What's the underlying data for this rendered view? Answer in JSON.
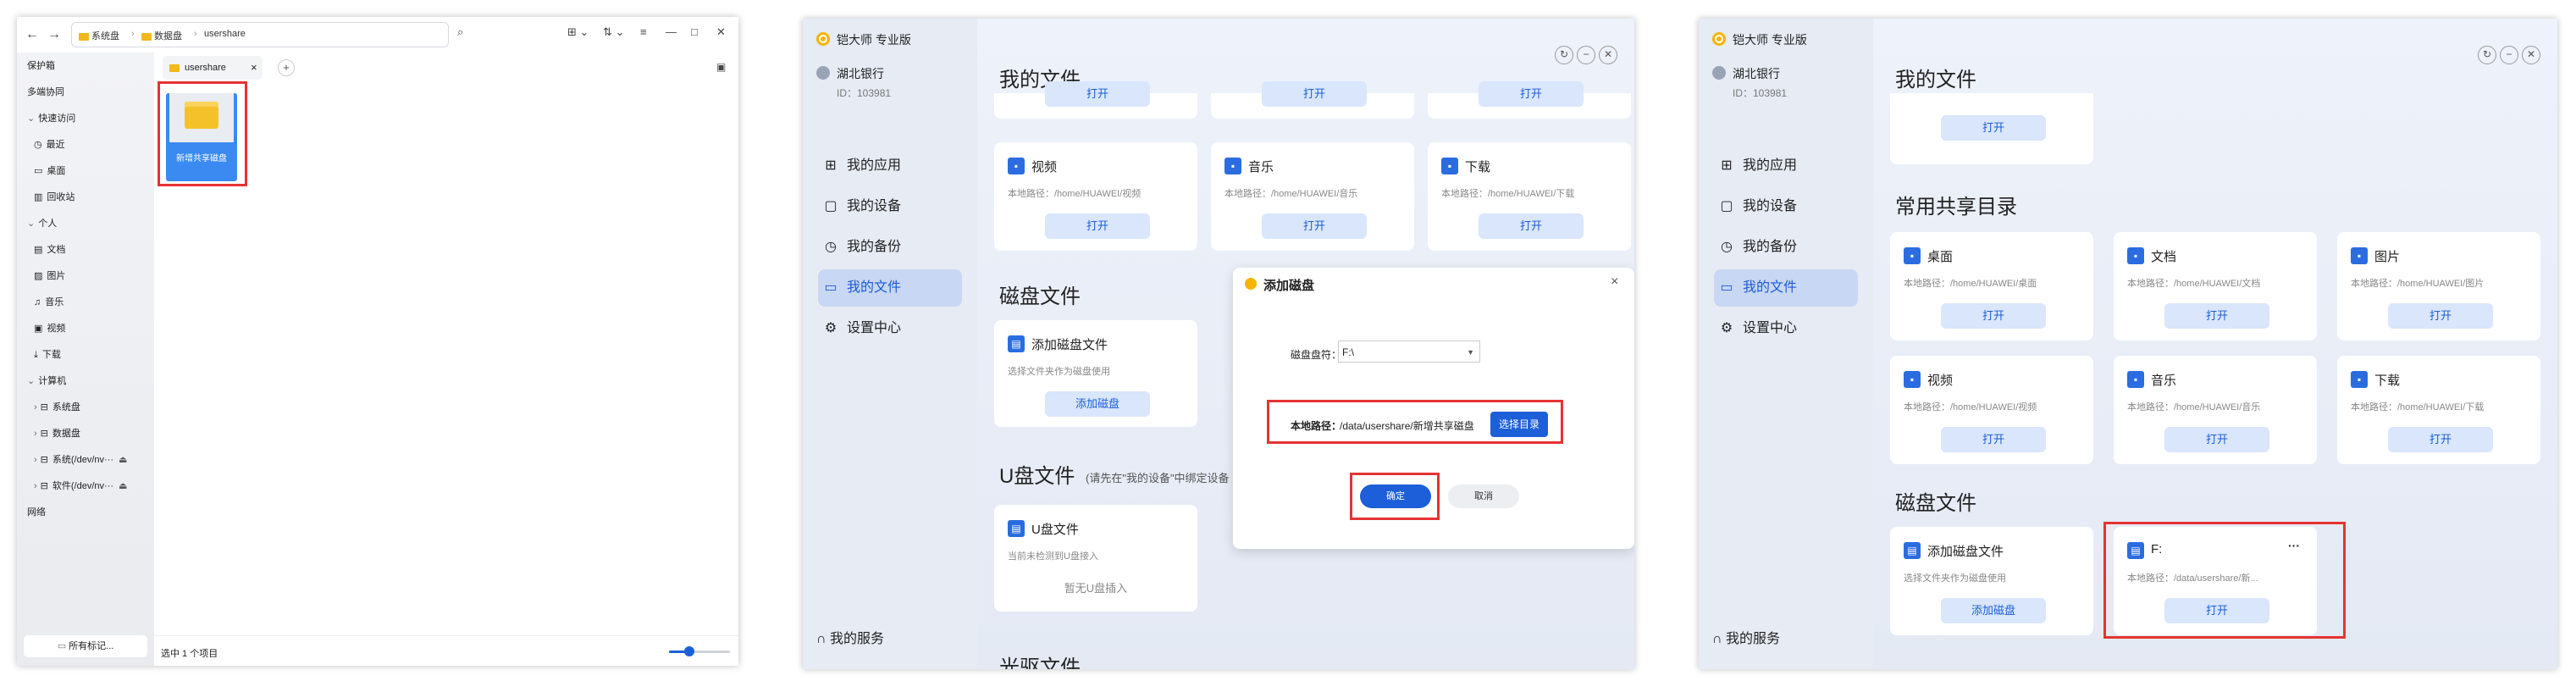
{
  "file_manager": {
    "nav": {
      "back": "←",
      "forward": "→"
    },
    "breadcrumb": [
      "系统盘",
      "数据盘",
      "usershare"
    ],
    "toolbar_icons": [
      "grid-view-icon",
      "sort-icon",
      "list-view-icon"
    ],
    "window_controls": [
      "—",
      "□",
      "✕"
    ],
    "sidebar": {
      "items": [
        {
          "label": "保护箱",
          "indent": 0
        },
        {
          "label": "多端协同",
          "indent": 0
        },
        {
          "label": "快速访问",
          "indent": 0,
          "chevron": "v"
        },
        {
          "label": "最近",
          "indent": 1,
          "icon": "clock-icon"
        },
        {
          "label": "桌面",
          "indent": 1,
          "icon": "desktop-icon"
        },
        {
          "label": "回收站",
          "indent": 1,
          "icon": "trash-icon"
        },
        {
          "label": "个人",
          "indent": 0,
          "chevron": "v"
        },
        {
          "label": "文档",
          "indent": 1,
          "icon": "document-icon"
        },
        {
          "label": "图片",
          "indent": 1,
          "icon": "image-icon"
        },
        {
          "label": "音乐",
          "indent": 1,
          "icon": "music-icon"
        },
        {
          "label": "视频",
          "indent": 1,
          "icon": "video-icon"
        },
        {
          "label": "下载",
          "indent": 1,
          "icon": "download-icon"
        },
        {
          "label": "计算机",
          "indent": 0,
          "chevron": "v"
        },
        {
          "label": "系统盘",
          "indent": 1,
          "icon": "disk-icon",
          "chevron": ">"
        },
        {
          "label": "数据盘",
          "indent": 1,
          "icon": "disk-icon",
          "chevron": ">"
        },
        {
          "label": "系统(/dev/nv···",
          "indent": 1,
          "icon": "disk-icon",
          "chevron": ">",
          "eject": true
        },
        {
          "label": "软件(/dev/nv···",
          "indent": 1,
          "icon": "disk-icon",
          "chevron": ">",
          "eject": true
        },
        {
          "label": "网络",
          "indent": 0
        }
      ],
      "tags_button": "所有标记..."
    },
    "tab": {
      "label": "usershare",
      "close": "×",
      "add": "+"
    },
    "folder": {
      "name": "新增共享磁盘"
    },
    "status": "选中 1 个项目",
    "zoom": 0.33
  },
  "app_common": {
    "title": "铠大师 专业版",
    "user": "湖北银行",
    "user_id": "ID：103981",
    "nav": [
      {
        "label": "我的应用",
        "icon": "apps-icon"
      },
      {
        "label": "我的设备",
        "icon": "device-icon"
      },
      {
        "label": "我的备份",
        "icon": "backup-icon"
      },
      {
        "label": "我的文件",
        "icon": "folder-icon"
      },
      {
        "label": "设置中心",
        "icon": "gear-icon"
      }
    ],
    "service": "我的服务",
    "page_title": "我的文件",
    "open": "打开"
  },
  "mid": {
    "media_cards": [
      {
        "title": "视频",
        "desc": "本地路径：/home/HUAWEI/视频"
      },
      {
        "title": "音乐",
        "desc": "本地路径：/home/HUAWEI/音乐"
      },
      {
        "title": "下载",
        "desc": "本地路径：/home/HUAWEI/下载"
      }
    ],
    "disk_section": "磁盘文件",
    "add_disk_card": {
      "title": "添加磁盘文件",
      "desc": "选择文件夹作为磁盘使用",
      "button": "添加磁盘"
    },
    "usb_section": "U盘文件",
    "usb_hint": "(请先在\"我的设备\"中绑定设备",
    "usb_card": {
      "title": "U盘文件",
      "desc": "当前未检测到U盘接入",
      "empty": "暂无U盘插入"
    },
    "partial_section": "光驱文件",
    "dialog": {
      "title": "添加磁盘",
      "drive_label": "磁盘盘符：",
      "drive_value": "F:\\",
      "path_label": "本地路径：",
      "path_value": "/data/usershare/新增共享磁盘",
      "choose_button": "选择目录",
      "confirm": "确定",
      "cancel": "取消"
    }
  },
  "right": {
    "shared_section": "常用共享目录",
    "shared_cards": [
      {
        "title": "桌面",
        "desc": "本地路径：/home/HUAWEI/桌面"
      },
      {
        "title": "文档",
        "desc": "本地路径：/home/HUAWEI/文档"
      },
      {
        "title": "图片",
        "desc": "本地路径：/home/HUAWEI/图片"
      },
      {
        "title": "视频",
        "desc": "本地路径：/home/HUAWEI/视频"
      },
      {
        "title": "音乐",
        "desc": "本地路径：/home/HUAWEI/音乐"
      },
      {
        "title": "下载",
        "desc": "本地路径：/home/HUAWEI/下载"
      }
    ],
    "disk_section": "磁盘文件",
    "add_disk_card": {
      "title": "添加磁盘文件",
      "desc": "选择文件夹作为磁盘使用",
      "button": "添加磁盘"
    },
    "f_card": {
      "title": "F:",
      "desc": "本地路径：/data/usershare/新...",
      "button": "打开",
      "more": "···"
    }
  },
  "colors": {
    "accent": "#1c5fd8",
    "highlight": "#e53333",
    "folder": "#f2b81c",
    "active_nav": "#c8d7f3"
  }
}
